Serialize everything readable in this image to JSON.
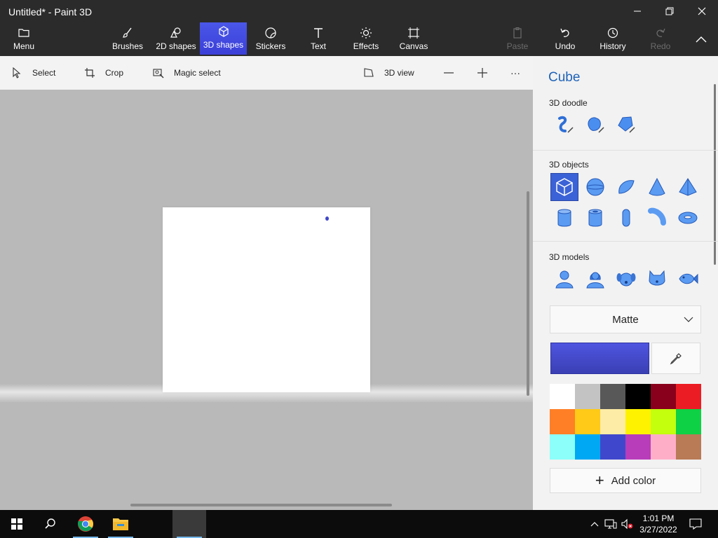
{
  "window": {
    "title": "Untitled* - Paint 3D"
  },
  "ribbon": {
    "menu": "Menu",
    "tools": [
      {
        "label": "Brushes",
        "icon": "brush-icon"
      },
      {
        "label": "2D shapes",
        "icon": "2d-shapes-icon"
      },
      {
        "label": "3D shapes",
        "icon": "3d-shapes-icon",
        "active": true
      },
      {
        "label": "Stickers",
        "icon": "stickers-icon"
      },
      {
        "label": "Text",
        "icon": "text-icon"
      },
      {
        "label": "Effects",
        "icon": "effects-icon"
      },
      {
        "label": "Canvas",
        "icon": "canvas-icon"
      }
    ],
    "paste": "Paste",
    "undo": "Undo",
    "history": "History",
    "redo": "Redo"
  },
  "toolbar": {
    "select": "Select",
    "crop": "Crop",
    "magic_select": "Magic select",
    "view_3d": "3D view",
    "more": "···"
  },
  "panel": {
    "title": "Cube",
    "doodle_title": "3D doodle",
    "objects_title": "3D objects",
    "models_title": "3D models",
    "material": "Matte",
    "add_color": "Add color",
    "selected_color": "#4048c8",
    "palette": [
      "#ffffff",
      "#c3c3c3",
      "#585858",
      "#000000",
      "#88001b",
      "#ec1c24",
      "#ff7f27",
      "#ffca18",
      "#fdeca6",
      "#fff200",
      "#c4ff0e",
      "#0ed145",
      "#8cfffb",
      "#00a8f3",
      "#3f48cc",
      "#b83dba",
      "#ffaec8",
      "#b97a56"
    ]
  },
  "taskbar": {
    "time": "1:01 PM",
    "date": "3/27/2022"
  }
}
